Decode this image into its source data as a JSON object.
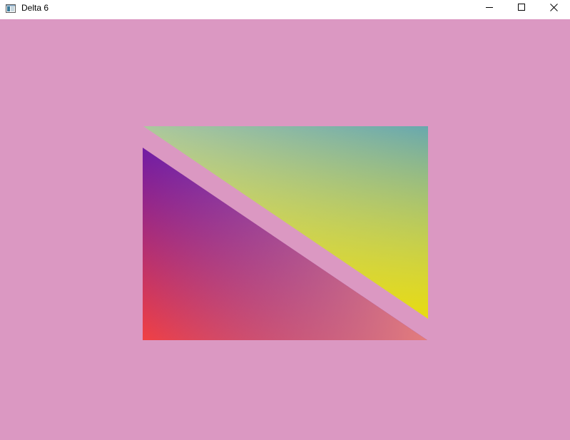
{
  "window": {
    "title": "Delta 6",
    "controls": {
      "minimize_icon": "minimize-icon",
      "maximize_icon": "maximize-icon",
      "close_icon": "close-icon"
    }
  },
  "canvas": {
    "background_color": "#db98c2",
    "upper_triangle": {
      "colors": [
        "#acc89e",
        "#68a8ae",
        "#e7db13"
      ]
    },
    "lower_triangle": {
      "colors": [
        "#711ca4",
        "#f14043",
        "#e47d7c"
      ]
    }
  }
}
